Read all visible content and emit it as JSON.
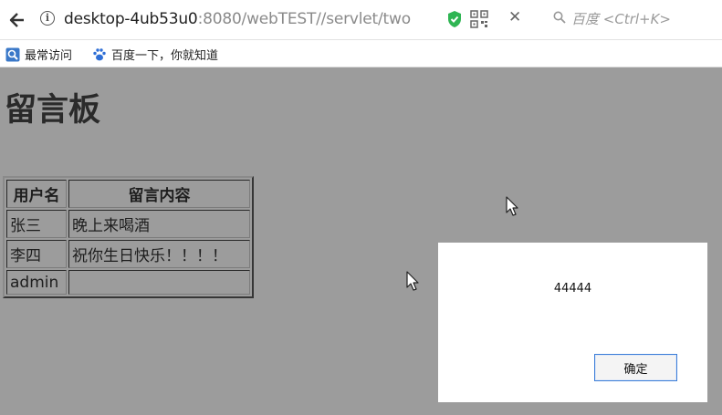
{
  "browser": {
    "url_host": "desktop-4ub53u0",
    "url_rest": ":8080/webTEST//servlet/two",
    "close_tab_glyph": "✕",
    "search_placeholder": "百度 <Ctrl+K>"
  },
  "bookmarks": [
    {
      "label": "最常访问",
      "icon": "search-bookmark-icon"
    },
    {
      "label": "百度一下，你就知道",
      "icon": "baidu-paw-icon"
    }
  ],
  "page": {
    "title": "留言板",
    "table": {
      "headers": [
        "用户名",
        "留言内容"
      ],
      "rows": [
        [
          "张三",
          "晚上来喝酒"
        ],
        [
          "李四",
          "祝你生日快乐！！！！"
        ],
        [
          "admin",
          ""
        ]
      ]
    }
  },
  "dialog": {
    "message": "44444",
    "ok_label": "确定"
  },
  "colors": {
    "overlay": "#9c9c9c",
    "button_border": "#3b7dd8"
  }
}
